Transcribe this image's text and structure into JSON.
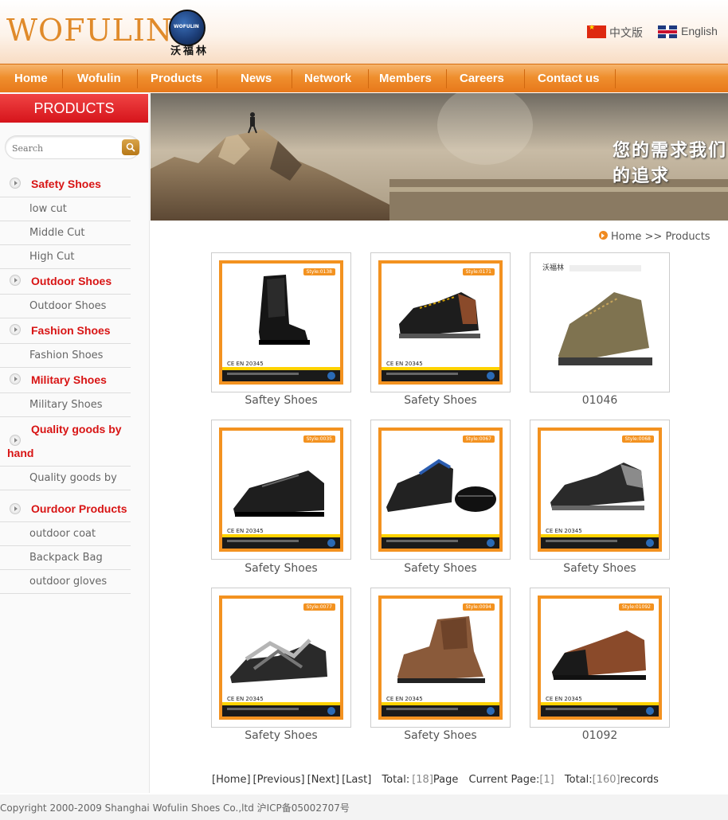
{
  "brand": {
    "name": "WOFULIN",
    "cn_name": "沃福林",
    "badge_text": "WOFULIN"
  },
  "languages": [
    {
      "label": "中文版",
      "flag": "china-flag-icon"
    },
    {
      "label": "English",
      "flag": "uk-flag-icon"
    }
  ],
  "nav": [
    "Home",
    "Wofulin",
    "Products",
    "News",
    "Network",
    "Members",
    "Careers",
    "Contact us"
  ],
  "sidebar": {
    "heading": "PRODUCTS",
    "search_placeholder": "Search",
    "categories": [
      {
        "label": "Safety Shoes",
        "subs": [
          "low cut",
          "Middle Cut",
          "High Cut"
        ]
      },
      {
        "label": "Outdoor Shoes",
        "subs": [
          "Outdoor Shoes"
        ]
      },
      {
        "label": "Fashion Shoes",
        "subs": [
          "Fashion Shoes"
        ]
      },
      {
        "label": "Military Shoes",
        "subs": [
          "Military Shoes"
        ]
      },
      {
        "label_line1": "Quality goods by",
        "label_line2": "hand",
        "subs": [
          "Quality goods by"
        ]
      },
      {
        "label": "Ourdoor Products",
        "subs": [
          "outdoor coat",
          "Backpack Bag",
          "outdoor gloves"
        ]
      }
    ]
  },
  "banner": {
    "slogan": "您的需求我们的追求"
  },
  "breadcrumb": "Home >> Products",
  "products": [
    {
      "caption": "Saftey Shoes",
      "style": "Style:0138",
      "cert": "CE EN 20345",
      "shoe": "boot-black"
    },
    {
      "caption": "Safety Shoes",
      "style": "Style:0171",
      "cert": "CE EN 20345",
      "shoe": "mid-black-brown"
    },
    {
      "caption": "01046",
      "style": "",
      "cert": "",
      "shoe": "hiker-khaki"
    },
    {
      "caption": "Safety Shoes",
      "style": "Style:0035",
      "cert": "CE EN 20345",
      "shoe": "low-black"
    },
    {
      "caption": "Safety Shoes",
      "style": "Style:0067",
      "cert": "",
      "shoe": "low-black-blue"
    },
    {
      "caption": "Safety Shoes",
      "style": "Style:0068",
      "cert": "CE EN 20345",
      "shoe": "low-black-grey"
    },
    {
      "caption": "Safety Shoes",
      "style": "Style:0077",
      "cert": "CE EN 20345",
      "shoe": "sandal"
    },
    {
      "caption": "Safety Shoes",
      "style": "Style:0094",
      "cert": "CE EN 20345",
      "shoe": "mid-brown"
    },
    {
      "caption": "01092",
      "style": "Style:01092",
      "cert": "CE EN 20345",
      "shoe": "low-brown-black"
    }
  ],
  "pager": {
    "home": "[Home]",
    "prev": "[Previous]",
    "next": "[Next]",
    "last": "[Last]",
    "total_label": "Total:",
    "total_pages": "[18]",
    "page_label": "Page",
    "current_label": "Current Page:",
    "current": "[1]",
    "records_label": "Total:",
    "records": "[160]",
    "records_unit": "records"
  },
  "footer": {
    "copyright": "Copyright 2000-2009 Shanghai Wofulin Shoes Co.,ltd 沪ICP备05002707号"
  }
}
